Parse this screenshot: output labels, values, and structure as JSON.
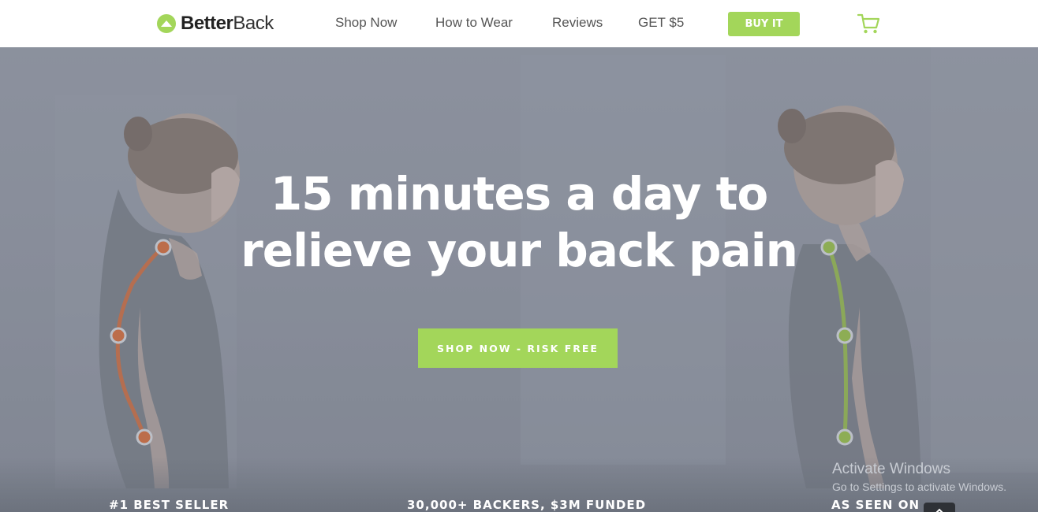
{
  "header": {
    "logo": {
      "bold": "Better",
      "light": "Back"
    },
    "nav": [
      {
        "label": "Shop Now"
      },
      {
        "label": "How to Wear"
      },
      {
        "label": "Reviews"
      },
      {
        "label": "GET $5"
      }
    ],
    "buy_label": "BUY IT",
    "cart_icon": "shopping-cart-icon"
  },
  "hero": {
    "title_line1": "15 minutes a day to",
    "title_line2": "relieve your back pain",
    "cta_label": "SHOP NOW - RISK FREE",
    "stats": [
      "#1 BEST SELLER",
      "30,000+ BACKERS, $3M FUNDED",
      "AS SEEN ON"
    ]
  },
  "watermark": {
    "title": "Activate Windows",
    "subtitle": "Go to Settings to activate Windows."
  },
  "colors": {
    "accent": "#a3d65a",
    "bad_posture": "#d0622c",
    "good_posture": "#8fba3a",
    "overlay": "#878d99"
  }
}
